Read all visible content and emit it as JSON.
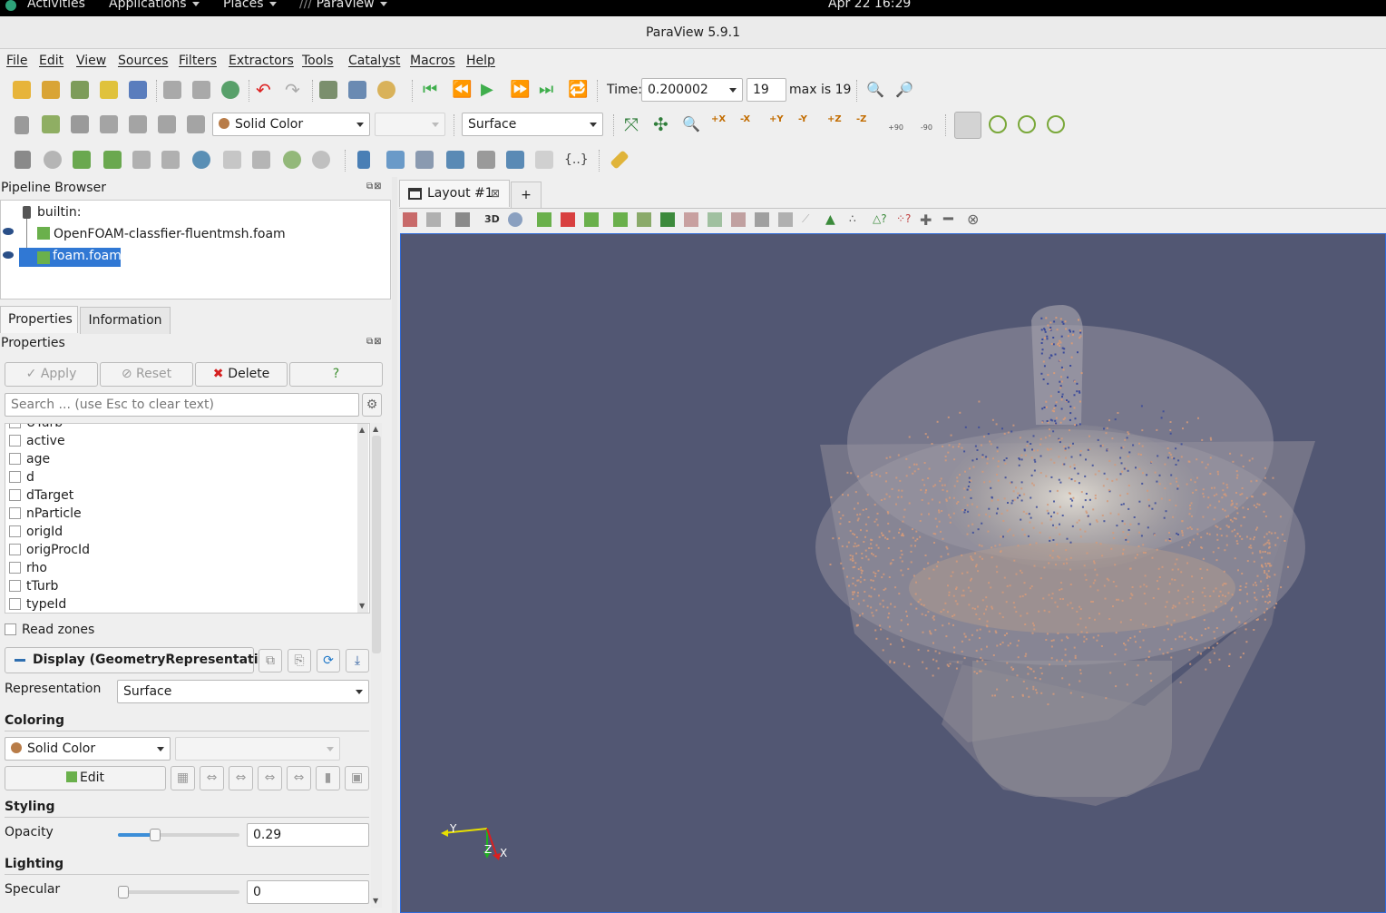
{
  "system_bar": {
    "activities": "Activities",
    "applications": "Applications",
    "places": "Places",
    "app_name": "ParaView",
    "clock": "Apr 22 16:29"
  },
  "window": {
    "title": "ParaView 5.9.1"
  },
  "menu": [
    "File",
    "Edit",
    "View",
    "Sources",
    "Filters",
    "Extractors",
    "Tools",
    "Catalyst",
    "Macros",
    "Help"
  ],
  "time_toolbar": {
    "time_label": "Time:",
    "time_value": "0.200002",
    "step_value": "19",
    "max_label": "max is 19"
  },
  "display_toolbar": {
    "coloring": "Solid Color",
    "component": "",
    "representation": "Surface",
    "camera_labels": [
      "+X",
      "-X",
      "+Y",
      "-Y",
      "+Z",
      "-Z",
      "+90",
      "-90"
    ]
  },
  "pipeline": {
    "title": "Pipeline Browser",
    "items": [
      {
        "label": "builtin:"
      },
      {
        "label": "OpenFOAM-classfier-fluentmsh.foam"
      },
      {
        "label": "foam.foam"
      }
    ]
  },
  "tabs": {
    "properties": "Properties",
    "information": "Information"
  },
  "properties": {
    "title": "Properties",
    "apply": "Apply",
    "reset": "Reset",
    "delete": "Delete",
    "help": "?",
    "search_placeholder": "Search ... (use Esc to clear text)",
    "arrays": [
      "UTurb",
      "active",
      "age",
      "d",
      "dTarget",
      "nParticle",
      "origId",
      "origProcId",
      "rho",
      "tTurb",
      "typeId"
    ],
    "read_zones": "Read zones",
    "display_section": "Display (GeometryRepresentation",
    "representation_label": "Representation",
    "representation_value": "Surface",
    "coloring_section": "Coloring",
    "coloring_value": "Solid Color",
    "coloring_component": "",
    "edit_button": "Edit",
    "styling_section": "Styling",
    "opacity_label": "Opacity",
    "opacity_value": "0.29",
    "opacity": 0.29,
    "lighting_section": "Lighting",
    "specular_label": "Specular",
    "specular_value": "0",
    "specular": 0
  },
  "view": {
    "layout_tab": "Layout #1",
    "add_tab": "+",
    "mode_3d": "3D",
    "axes": {
      "y": "Y",
      "z": "Z",
      "x": "X"
    },
    "colors": {
      "background": "#525773",
      "geometry": "#9d9aa1",
      "particles_warm": "#d49a7a",
      "particles_cool": "#3a4a9a"
    }
  }
}
